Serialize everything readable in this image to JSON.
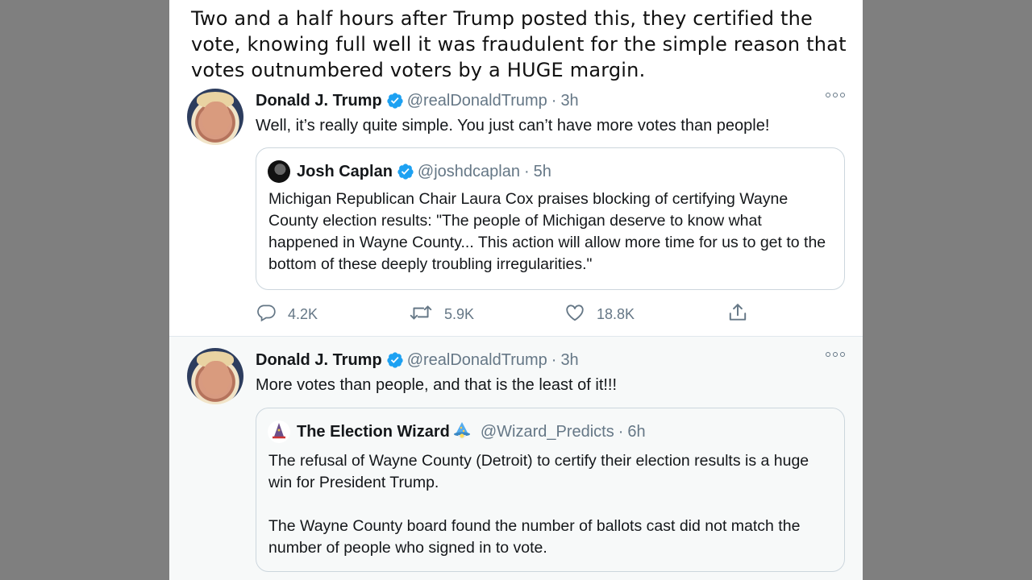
{
  "caption": "Two and a half hours after Trump posted this, they certified the vote, knowing full well it was fraudulent for the simple reason that votes outnumbered voters by a HUGE margin.",
  "icons": {
    "verified": "verified-badge-icon",
    "more": "more-options-icon",
    "reply": "reply-icon",
    "retweet": "retweet-icon",
    "like": "heart-icon",
    "share": "share-icon",
    "wizard": "wizard-emoji"
  },
  "colors": {
    "verified": "#1da1f2",
    "muted": "#657786",
    "text": "#14171a",
    "border": "#ccd6dd"
  },
  "tweets": [
    {
      "name": "Donald J. Trump",
      "handle": "@realDonaldTrump",
      "sep": "·",
      "time": "3h",
      "text": "Well, it’s really quite simple. You just can’t have more votes than people!",
      "quote": {
        "name": "Josh Caplan",
        "handle": "@joshdcaplan",
        "sep": "·",
        "time": "5h",
        "paragraphs": [
          "Michigan Republican Chair Laura Cox praises blocking of certifying Wayne County election results: \"The people of Michigan deserve to know what happened in Wayne County... This action will allow more time for us to get to the bottom of these deeply troubling irregularities.\""
        ]
      },
      "actions": {
        "replies": "4.2K",
        "retweets": "5.9K",
        "likes": "18.8K"
      }
    },
    {
      "name": "Donald J. Trump",
      "handle": "@realDonaldTrump",
      "sep": "·",
      "time": "3h",
      "text": "More votes than people, and that is the least of it!!!",
      "quote": {
        "name": "The Election Wizard",
        "handle": "@Wizard_Predicts",
        "sep": "·",
        "time": "6h",
        "paragraphs": [
          "The refusal of Wayne County (Detroit) to certify their election results is a huge win for President Trump.",
          "The Wayne County board found the number of ballots cast did not match the number of people who signed in to vote."
        ]
      }
    }
  ]
}
